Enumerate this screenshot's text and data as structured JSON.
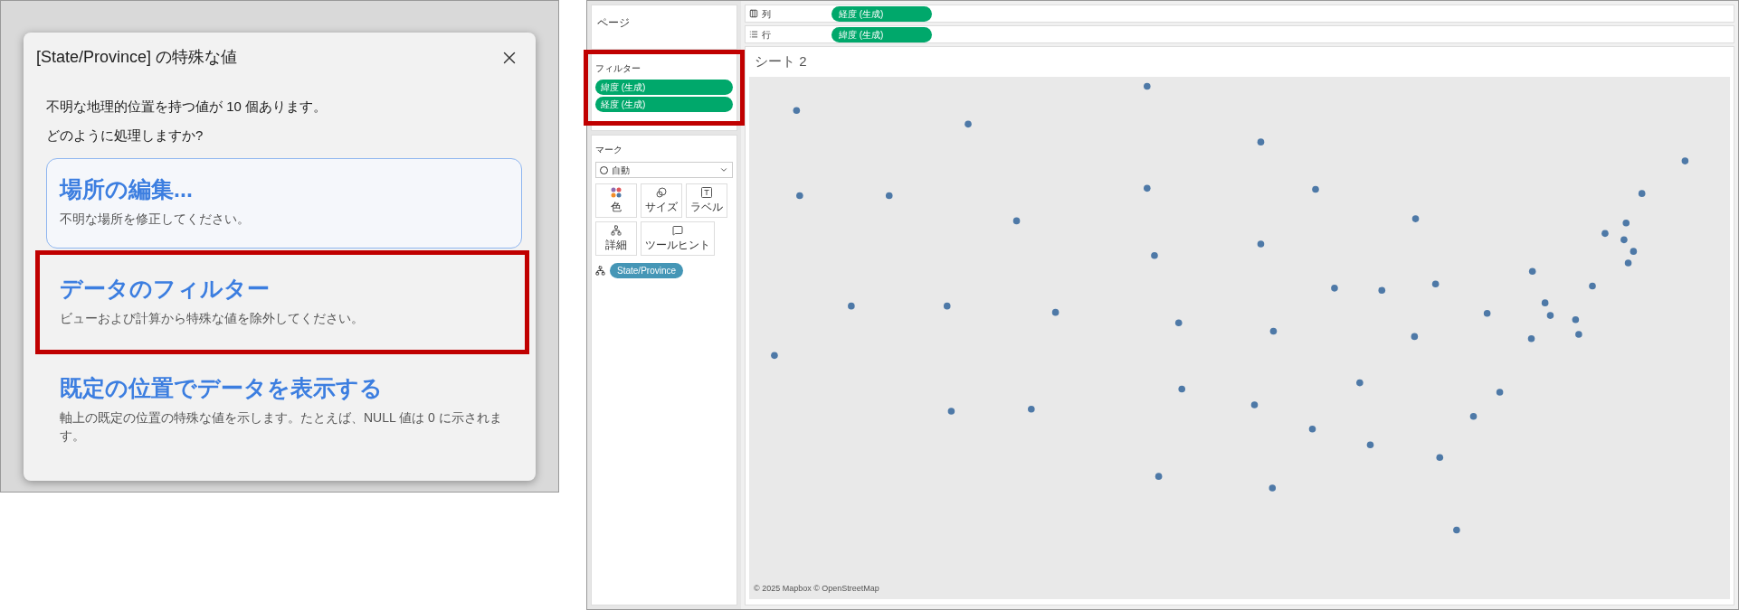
{
  "dialog": {
    "title": "[State/Province] の特殊な値",
    "message": [
      "不明な地理的位置を持つ値が 10 個あります。",
      "どのように処理しますか?"
    ],
    "options": [
      {
        "title": "場所の編集...",
        "description": "不明な場所を修正してください。",
        "selected": true,
        "highlighted": false
      },
      {
        "title": "データのフィルター",
        "description": "ビューおよび計算から特殊な値を除外してください。",
        "selected": false,
        "highlighted": true
      },
      {
        "title": "既定の位置でデータを表示する",
        "description": "軸上の既定の位置の特殊な値を示します。たとえば、NULL 値は 0 に示されます。",
        "selected": false,
        "highlighted": false
      }
    ]
  },
  "workspace": {
    "pages_label": "ページ",
    "filters": {
      "label": "フィルター",
      "pills": [
        "緯度 (生成)",
        "経度 (生成)"
      ],
      "highlighted": true
    },
    "marks": {
      "label": "マーク",
      "mark_type": "自動",
      "cards": [
        {
          "kind": "color",
          "label": "色"
        },
        {
          "kind": "size",
          "label": "サイズ"
        },
        {
          "kind": "label",
          "label": "ラベル"
        },
        {
          "kind": "detail",
          "label": "詳細"
        },
        {
          "kind": "tooltip",
          "label": "ツールヒント"
        }
      ],
      "detail_pill": "State/Province"
    },
    "columns_shelf": {
      "label": "列",
      "pill": "経度 (生成)"
    },
    "rows_shelf": {
      "label": "行",
      "pill": "緯度 (生成)"
    },
    "sheet_title": "シート 2",
    "map_attribution": "© 2025 Mapbox © OpenStreetMap"
  }
}
